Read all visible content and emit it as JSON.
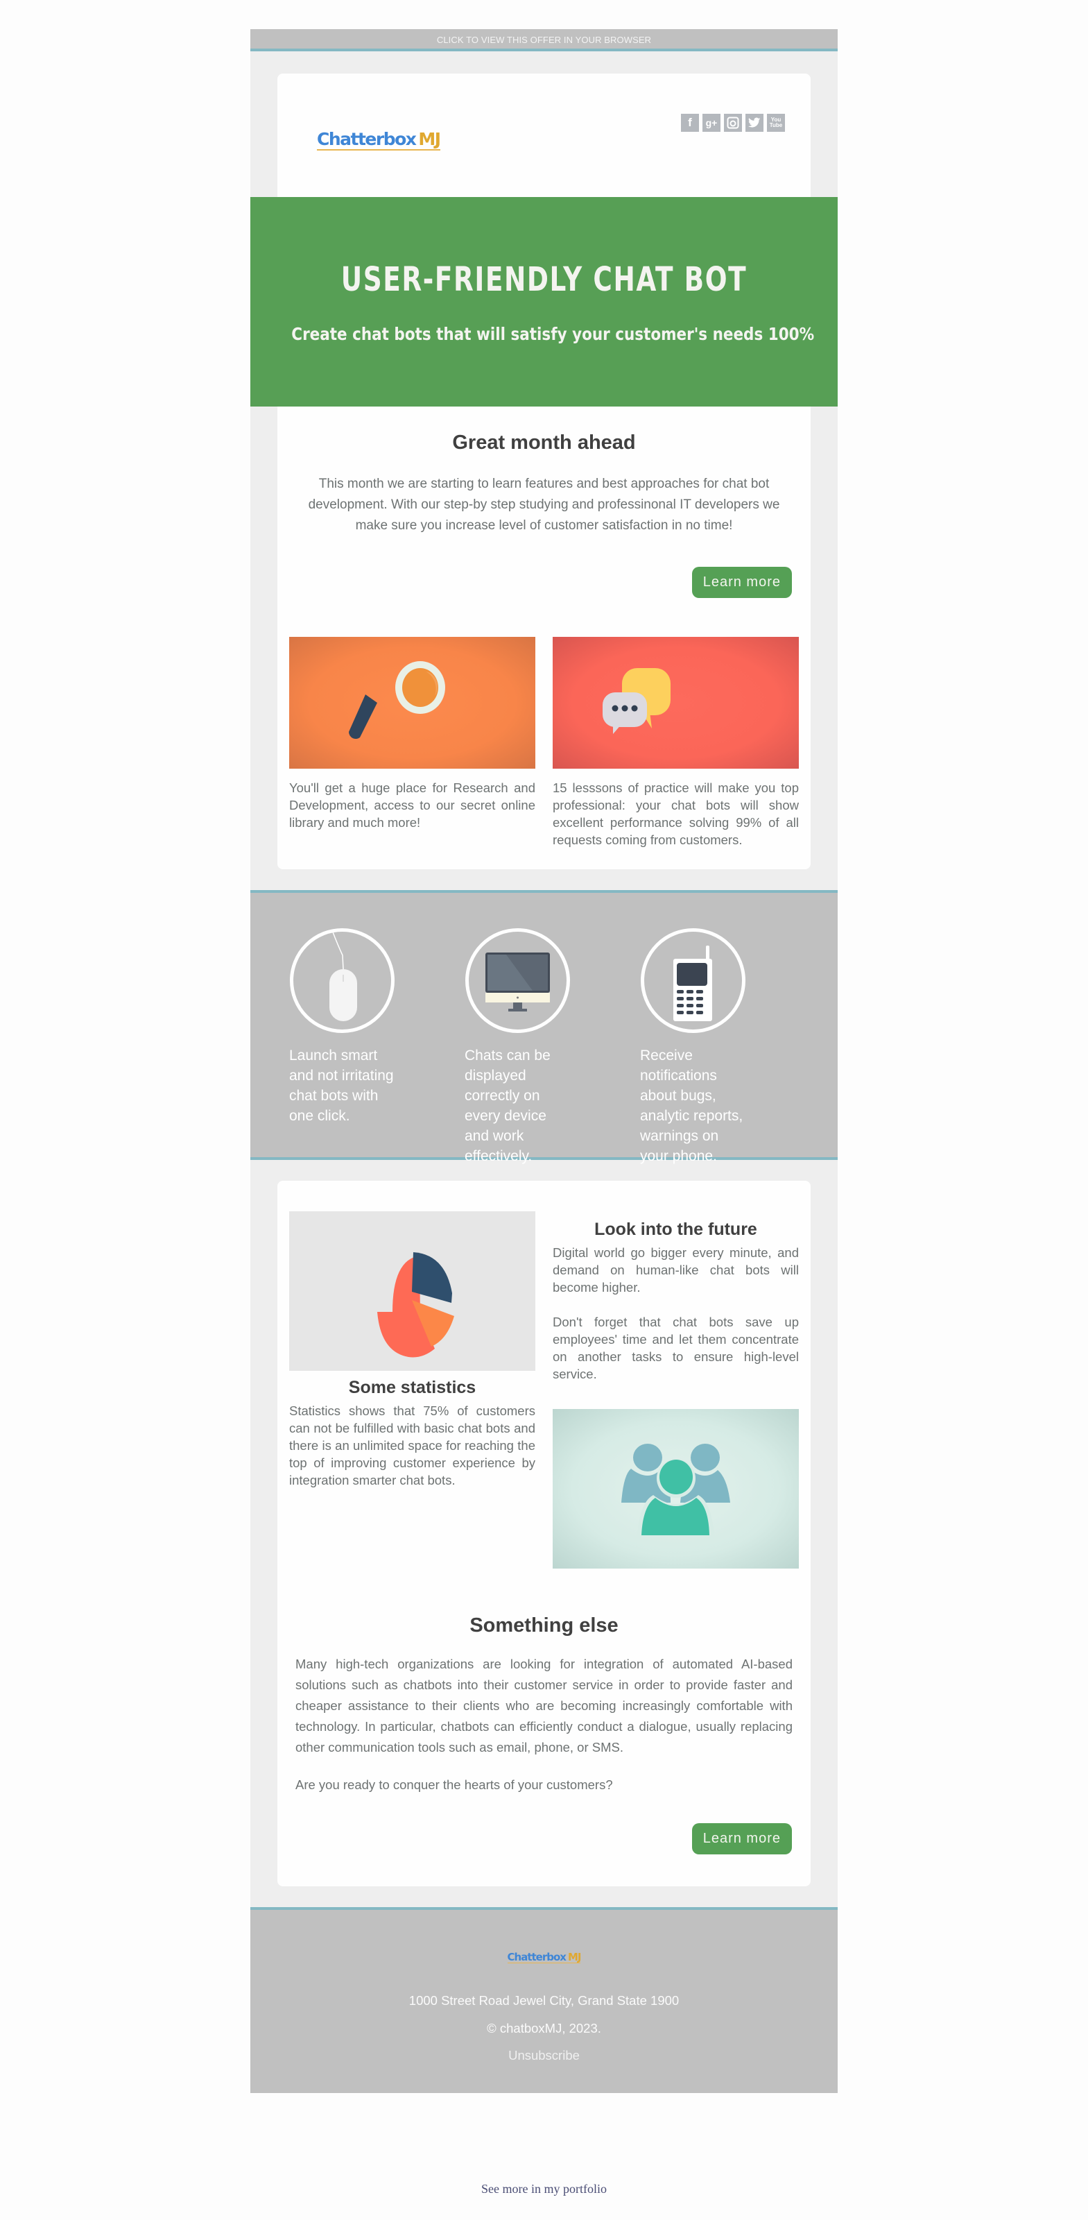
{
  "topbar": {
    "view_in_browser": "CLICK TO VIEW THIS OFFER IN YOUR BROWSER"
  },
  "brand": {
    "name_part1": "Chatterbox",
    "name_part2": "MJ"
  },
  "social": [
    {
      "icon": "facebook-icon",
      "glyph": "f"
    },
    {
      "icon": "google-plus-icon",
      "glyph": "g+"
    },
    {
      "icon": "instagram-icon",
      "glyph": "◎"
    },
    {
      "icon": "twitter-icon",
      "glyph": "🐦"
    },
    {
      "icon": "youtube-icon",
      "glyph_top": "You",
      "glyph_bottom": "Tube"
    }
  ],
  "hero": {
    "title": "USER-FRIENDLY CHAT BOT",
    "subtitle": "Create chat bots that will satisfy your customer's needs 100%",
    "background": "#579f55"
  },
  "intro": {
    "heading": "Great month ahead",
    "text": "This month we are starting to learn features and best approaches for chat bot development. With our step-by step studying and professinonal IT developers we make sure you increase level of customer satisfaction in no time!",
    "button": "Learn more"
  },
  "columns": [
    {
      "image": "magnifier-illustration",
      "text": "You'll get a huge place for Research and Development, access to our secret online library and much more!"
    },
    {
      "image": "chat-bubbles-illustration",
      "text": "15 lesssons of practice will make you top professional: your chat bots will show excellent performance solving 99% of all requests coming from customers."
    }
  ],
  "features": [
    {
      "icon": "mouse-icon",
      "text": "Launch smart and not irritating chat bots with one click."
    },
    {
      "icon": "monitor-icon",
      "text": "Chats can be displayed correctly on every device and work effectively."
    },
    {
      "icon": "mobile-phone-icon",
      "text": "Receive notifications about bugs, analytic reports, warnings on your phone."
    }
  ],
  "stats": {
    "heading": "Some statistics",
    "text": "Statistics shows that 75% of customers can not be fulfilled with basic chat bots and there is an unlimited space for reaching the top of improving customer experience by integration smarter chat bots."
  },
  "future": {
    "heading": "Look into the future",
    "text1": "Digital world go bigger every minute, and demand on human-like chat bots will become higher.",
    "text2": "Don't forget that chat bots save up employees' time and let them concentrate on another tasks to ensure high-level service."
  },
  "something_else": {
    "heading": "Something else",
    "text": "Many high-tech organizations are looking for integration of automated AI-based solutions such as chatbots into their customer service in order to provide faster and cheaper assistance to their clients who are becoming increasingly comfortable with technology. In particular, chatbots can efficiently conduct a dialogue, usually replacing other communication tools such as email, phone, or SMS.",
    "question": "Are you ready to conquer the hearts of your customers?",
    "button": "Learn more"
  },
  "footer": {
    "address": "1000 Street Road Jewel City, Grand State 1900",
    "copyright": "© chatboxMJ, 2023.",
    "unsubscribe": "Unsubscribe"
  },
  "portfolio_link": "See more in my portfolio",
  "colors": {
    "accent_green": "#55a055",
    "teal_border": "#84b8c3",
    "gray_band": "#c0c0c0",
    "brand_blue": "#3f86d6",
    "brand_gold": "#e0a830"
  }
}
